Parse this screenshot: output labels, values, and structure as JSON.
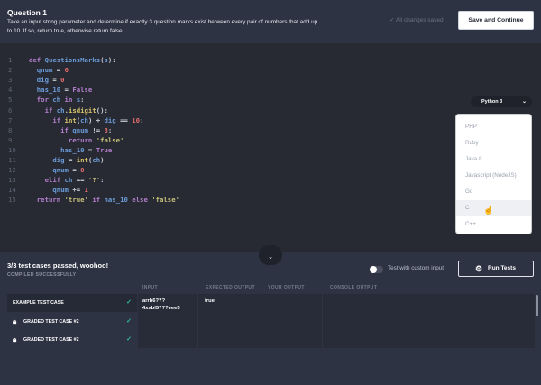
{
  "header": {
    "title": "Question 1",
    "description": "Take an input string parameter and determine if exactly 3 question marks exist between every pair of numbers that add up to 10. If so, return true, otherwise return false.",
    "saved_status": "✓  All changes saved",
    "save_button": "Save and Continue"
  },
  "editor": {
    "language": "Python 3",
    "lines": [
      [
        [
          "def ",
          "kw"
        ],
        [
          "QuestionsMarks",
          "id"
        ],
        [
          "(",
          "p"
        ],
        [
          "s",
          "id"
        ],
        [
          "):",
          "p"
        ]
      ],
      [
        [
          "  qnum ",
          "id"
        ],
        [
          "= ",
          "p"
        ],
        [
          "0",
          "num"
        ]
      ],
      [
        [
          "  dig ",
          "id"
        ],
        [
          "= ",
          "p"
        ],
        [
          "0",
          "num"
        ]
      ],
      [
        [
          "  has_10 ",
          "id"
        ],
        [
          "= ",
          "p"
        ],
        [
          "False",
          "kw"
        ]
      ],
      [
        [
          "  for ",
          "kw"
        ],
        [
          "ch ",
          "id"
        ],
        [
          "in ",
          "kw"
        ],
        [
          "s",
          "id"
        ],
        [
          ":",
          "p"
        ]
      ],
      [
        [
          "    if ",
          "kw"
        ],
        [
          "ch",
          "id"
        ],
        [
          ".",
          "p"
        ],
        [
          "isdigit",
          "fn"
        ],
        [
          "():",
          "p"
        ]
      ],
      [
        [
          "      if ",
          "kw"
        ],
        [
          "int",
          "fn"
        ],
        [
          "(",
          "p"
        ],
        [
          "ch",
          "id"
        ],
        [
          ") + ",
          "p"
        ],
        [
          "dig ",
          "id"
        ],
        [
          "== ",
          "p"
        ],
        [
          "10",
          "num"
        ],
        [
          ":",
          "p"
        ]
      ],
      [
        [
          "        if ",
          "kw"
        ],
        [
          "qnum ",
          "id"
        ],
        [
          "!= ",
          "p"
        ],
        [
          "3",
          "num"
        ],
        [
          ":",
          "p"
        ]
      ],
      [
        [
          "          return ",
          "kw"
        ],
        [
          "'false'",
          "str"
        ]
      ],
      [
        [
          "        has_10 ",
          "id"
        ],
        [
          "= ",
          "p"
        ],
        [
          "True",
          "kw"
        ]
      ],
      [
        [
          "      dig ",
          "id"
        ],
        [
          "= ",
          "p"
        ],
        [
          "int",
          "fn"
        ],
        [
          "(",
          "p"
        ],
        [
          "ch",
          "id"
        ],
        [
          ")",
          "p"
        ]
      ],
      [
        [
          "      qnum ",
          "id"
        ],
        [
          "= ",
          "p"
        ],
        [
          "0",
          "num"
        ]
      ],
      [
        [
          "    elif ",
          "kw"
        ],
        [
          "ch ",
          "id"
        ],
        [
          "== ",
          "p"
        ],
        [
          "'?'",
          "str"
        ],
        [
          ":",
          "p"
        ]
      ],
      [
        [
          "      qnum ",
          "id"
        ],
        [
          "+= ",
          "p"
        ],
        [
          "1",
          "num"
        ]
      ],
      [
        [
          "  return ",
          "kw"
        ],
        [
          "'true' ",
          "str"
        ],
        [
          "if ",
          "kw"
        ],
        [
          "has_10 ",
          "id"
        ],
        [
          "else ",
          "kw"
        ],
        [
          "'false'",
          "str"
        ]
      ]
    ],
    "language_options": [
      "PHP",
      "Ruby",
      "Java 8",
      "Javascript (NodeJS)",
      "Go",
      "C",
      "C++"
    ],
    "highlighted_option": "C"
  },
  "results": {
    "title": "3/3 test cases passed, woohoo!",
    "subtitle": "COMPILED SUCCESSFULLY",
    "toggle_label": "Test with custom input",
    "toggle_on": false,
    "run_button": "Run Tests",
    "columns": [
      "INPUT",
      "EXPECTED OUTPUT",
      "YOUR OUTPUT",
      "CONSOLE OUTPUT"
    ],
    "cases": [
      {
        "label": "EXAMPLE TEST CASE",
        "locked": false,
        "passed": true
      },
      {
        "label": "GRADED TEST CASE #2",
        "locked": true,
        "passed": true
      },
      {
        "label": "GRADED TEST CASE #2",
        "locked": true,
        "passed": true
      }
    ],
    "selected": {
      "input": "arrb6???\n4xxbl5???eee5",
      "expected": "true",
      "yours": "",
      "console": ""
    }
  },
  "colors": {
    "pass": "#2fbf9a",
    "header_bg": "#2e3343",
    "editor_bg": "#272a33"
  }
}
